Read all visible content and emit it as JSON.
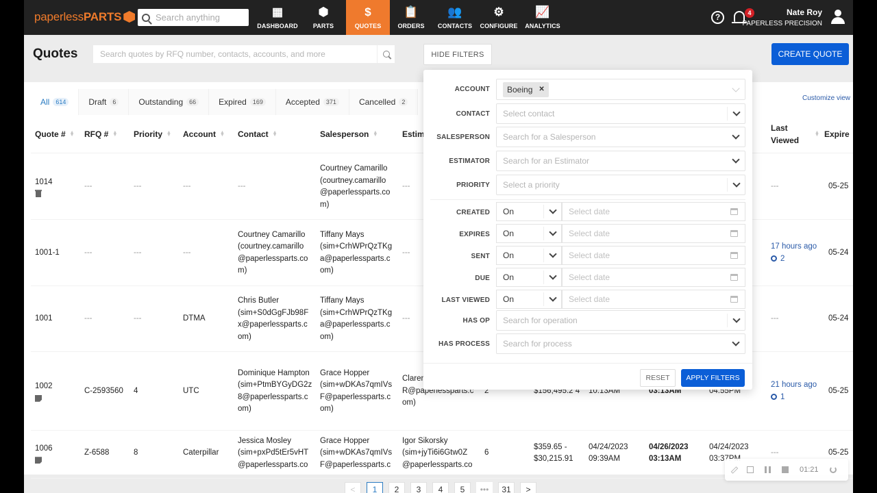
{
  "nav": {
    "logo_light": "paperless",
    "logo_bold": "PARTS",
    "search_placeholder": "Search anything",
    "items": [
      {
        "label": "DASHBOARD",
        "icon": "▦"
      },
      {
        "label": "PARTS",
        "icon": "⬢"
      },
      {
        "label": "QUOTES",
        "icon": "$",
        "active": true
      },
      {
        "label": "ORDERS",
        "icon": "📋"
      },
      {
        "label": "CONTACTS",
        "icon": "👥"
      },
      {
        "label": "CONFIGURE",
        "icon": "⚙"
      },
      {
        "label": "ANALYTICS",
        "icon": "📈"
      }
    ],
    "help_icon": "?",
    "notification_count": "4",
    "user_name": "Nate Roy",
    "user_org": "PAPERLESS PRECISION"
  },
  "page": {
    "title": "Quotes",
    "search_placeholder": "Search quotes by RFQ number, contacts, accounts, and more",
    "hide_filters": "HIDE FILTERS",
    "create_quote": "CREATE QUOTE",
    "customize_view": "Customize view"
  },
  "tabs": [
    {
      "label": "All",
      "count": "614",
      "active": true
    },
    {
      "label": "Draft",
      "count": "6"
    },
    {
      "label": "Outstanding",
      "count": "66"
    },
    {
      "label": "Expired",
      "count": "169"
    },
    {
      "label": "Accepted",
      "count": "371"
    },
    {
      "label": "Cancelled",
      "count": "2"
    }
  ],
  "columns": [
    "Quote #",
    "RFQ #",
    "Priority",
    "Account",
    "Contact",
    "Salesperson",
    "Estim",
    "Last Viewed",
    "Expire"
  ],
  "rows": [
    {
      "quote": "1014",
      "icon": "trash",
      "rfq": "---",
      "priority": "---",
      "account": "---",
      "contact": "---",
      "salesperson": "Courtney Camarillo (courtney.camarillo @paperlessparts.co m)",
      "estimator": "---",
      "last_viewed": "---",
      "views": "",
      "expires": "05-25"
    },
    {
      "quote": "1001-1",
      "icon": "",
      "rfq": "---",
      "priority": "---",
      "account": "---",
      "contact": "Courtney Camarillo (courtney.camarillo @paperlessparts.co m)",
      "salesperson": "Tiffany Mays (sim+CrhWPrQzTKg a@paperlessparts.c om)",
      "estimator": "---",
      "last_viewed": "17 hours ago",
      "views": "2",
      "expires": "05-24"
    },
    {
      "quote": "1001",
      "icon": "",
      "rfq": "---",
      "priority": "---",
      "account": "DTMA",
      "contact": "Chris Butler (sim+S0dGgFJb98F x@paperlessparts.c om)",
      "salesperson": "Tiffany Mays (sim+CrhWPrQzTKg a@paperlessparts.c om)",
      "estimator": "---",
      "last_viewed": "---",
      "views": "",
      "expires": "05-24"
    },
    {
      "quote": "1002",
      "icon": "note",
      "rfq": "C-2593560",
      "priority": "4",
      "account": "UTC",
      "contact": "Dominique Hampton (sim+PtmBYGyDG2z 8@paperlessparts.c om)",
      "salesperson": "Grace Hopper (sim+wDKAs7qmIVs F@paperlessparts.c om)",
      "estimator": "Claren (sim+ R@paperlessparts.c om)",
      "items": "2",
      "price": "$156,495.2 4",
      "created": "10:13AM",
      "due": "03:13AM",
      "sent": "04:55PM",
      "last_viewed": "21 hours ago",
      "views": "1",
      "expires": "05-25"
    },
    {
      "quote": "1006",
      "icon": "note",
      "rfq": "Z-6588",
      "priority": "8",
      "account": "Caterpillar",
      "contact": "Jessica Mosley (sim+pxPd5tEr5vHT @paperlessparts.co",
      "salesperson": "Grace Hopper (sim+wDKAs7qmIVs F@paperlessparts.c",
      "estimator": "Igor Sikorsky (sim+jyTi6i6Gtw0Z @paperlessparts.co",
      "items": "6",
      "price": "$359.65 - $30,215.91",
      "created": "04/24/2023 09:39AM",
      "due": "04/26/2023 03:13AM",
      "sent": "04/24/2023 03:37PM",
      "last_viewed": "---",
      "views": "",
      "expires": "05-25"
    }
  ],
  "filters": {
    "account_label": "ACCOUNT",
    "account_chip": "Boeing",
    "contact_label": "CONTACT",
    "contact_placeholder": "Select contact",
    "salesperson_label": "SALESPERSON",
    "salesperson_placeholder": "Search for a Salesperson",
    "estimator_label": "ESTIMATOR",
    "estimator_placeholder": "Search for an Estimator",
    "priority_label": "PRIORITY",
    "priority_placeholder": "Select a priority",
    "date_rows": [
      {
        "label": "CREATED",
        "op": "On",
        "placeholder": "Select date"
      },
      {
        "label": "EXPIRES",
        "op": "On",
        "placeholder": "Select date"
      },
      {
        "label": "SENT",
        "op": "On",
        "placeholder": "Select date"
      },
      {
        "label": "DUE",
        "op": "On",
        "placeholder": "Select date"
      },
      {
        "label": "LAST VIEWED",
        "op": "On",
        "placeholder": "Select date"
      }
    ],
    "has_op_label": "HAS OP",
    "has_op_placeholder": "Search for operation",
    "has_process_label": "HAS PROCESS",
    "has_process_placeholder": "Search for process",
    "reset": "RESET",
    "apply": "APPLY FILTERS"
  },
  "pagination": {
    "prev": "<",
    "pages": [
      "1",
      "2",
      "3",
      "4",
      "5"
    ],
    "ellipsis": "•••",
    "last": "31",
    "next": ">",
    "current": "1"
  },
  "recorder": {
    "time": "01:21"
  }
}
